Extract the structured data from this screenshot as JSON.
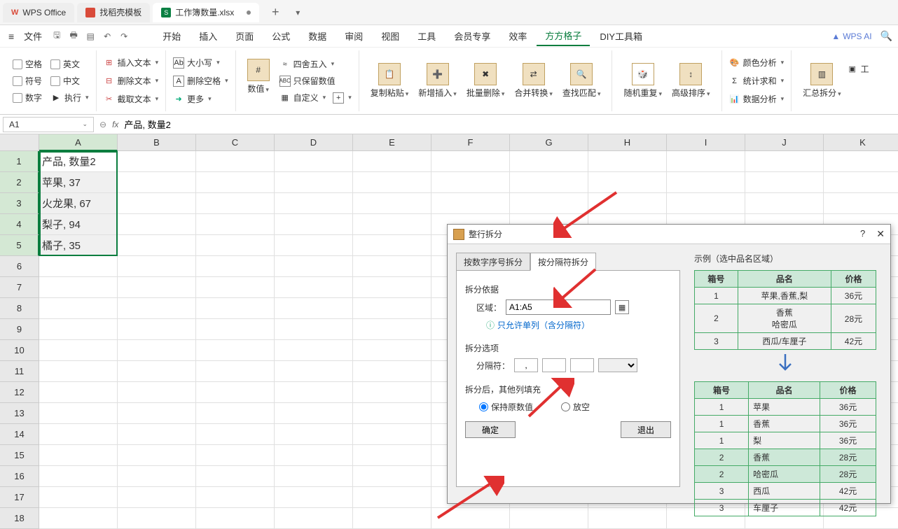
{
  "tabs": {
    "app": "WPS Office",
    "template": "找稻壳模板",
    "doc": "工作簿数量.xlsx"
  },
  "menu": {
    "file": "文件",
    "items": [
      "开始",
      "插入",
      "页面",
      "公式",
      "数据",
      "审阅",
      "视图",
      "工具",
      "会员专享",
      "效率",
      "方方格子",
      "DIY工具箱"
    ],
    "active_index": 10,
    "wps_ai": "WPS AI"
  },
  "ribbon": {
    "g1": {
      "a": "空格",
      "b": "英文",
      "c": "符号",
      "d": "中文",
      "e": "数字",
      "f": "执行"
    },
    "g2": {
      "a": "插入文本",
      "b": "删除文本",
      "c": "截取文本"
    },
    "g3": {
      "a": "大小写",
      "b": "删除空格",
      "c": "更多"
    },
    "g4": {
      "a": "数值",
      "b": "四舍五入",
      "c": "只保留数值",
      "d": "自定义"
    },
    "g5": {
      "a": "复制粘贴",
      "b": "新增插入",
      "c": "批量删除",
      "d": "合并转换",
      "e": "查找匹配"
    },
    "g6": {
      "a": "随机重复",
      "b": "高级排序"
    },
    "g7": {
      "a": "颜色分析",
      "b": "统计求和",
      "c": "数据分析"
    },
    "g8": {
      "a": "汇总拆分",
      "b": "工"
    }
  },
  "name_box": "A1",
  "formula": "产品, 数量2",
  "columns": [
    "A",
    "B",
    "C",
    "D",
    "E",
    "F",
    "G",
    "H",
    "I",
    "J",
    "K"
  ],
  "rows": [
    "1",
    "2",
    "3",
    "4",
    "5",
    "6",
    "7",
    "8",
    "9",
    "10",
    "11",
    "12",
    "13",
    "14",
    "15",
    "16",
    "17",
    "18"
  ],
  "cells": {
    "a1": "产品, 数量2",
    "a2": "苹果, 37",
    "a3": "火龙果, 67",
    "a4": "梨子, 94",
    "a5": "橘子, 35"
  },
  "dialog": {
    "title": "整行拆分",
    "help": "?",
    "tab1": "按数字序号拆分",
    "tab2": "按分隔符拆分",
    "basis_label": "拆分依据",
    "range_label": "区域：",
    "range_value": "A1:A5",
    "hint": "只允许单列（含分隔符）",
    "options_label": "拆分选项",
    "sep_label": "分隔符：",
    "sep_value": ",",
    "after_label": "拆分后，其他列填充",
    "radio1": "保持原数值",
    "radio2": "放空",
    "ok": "确定",
    "cancel": "退出",
    "example_label": "示例（选中品名区域）",
    "ex1_headers": [
      "箱号",
      "品名",
      "价格"
    ],
    "ex1_rows": [
      [
        "1",
        "苹果,香蕉,梨",
        "36元"
      ],
      [
        "2",
        "香蕉\n哈密瓜",
        "28元"
      ],
      [
        "3",
        "西瓜/车厘子",
        "42元"
      ]
    ],
    "ex2_headers": [
      "箱号",
      "品名",
      "价格"
    ],
    "ex2_rows": [
      [
        "1",
        "苹果",
        "36元"
      ],
      [
        "1",
        "香蕉",
        "36元"
      ],
      [
        "1",
        "梨",
        "36元"
      ],
      [
        "2",
        "香蕉",
        "28元"
      ],
      [
        "2",
        "哈密瓜",
        "28元"
      ],
      [
        "3",
        "西瓜",
        "42元"
      ],
      [
        "3",
        "车厘子",
        "42元"
      ]
    ]
  }
}
